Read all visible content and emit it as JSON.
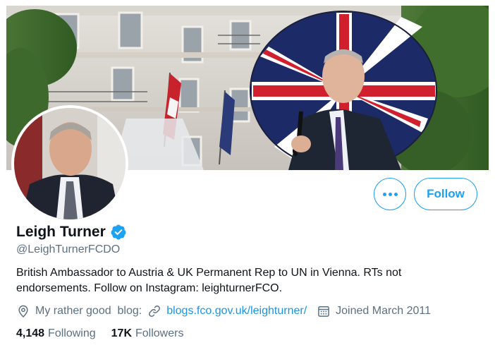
{
  "colors": {
    "accent": "#1da1f2",
    "link": "#1b95e0",
    "secondary_text": "#5b7083",
    "primary_text": "#0f1419"
  },
  "profile": {
    "display_name": "Leigh Turner",
    "verified": true,
    "handle": "@LeighTurnerFCDO",
    "bio": "British Ambassador to Austria & UK Permanent Rep to UN in Vienna. RTs not endorsements. Follow on Instagram: leighturnerFCO.",
    "location": "My rather good  blog:",
    "website": "blogs.fco.gov.uk/leighturner/",
    "joined": "Joined March 2011"
  },
  "stats": {
    "following_count": "4,148",
    "following_label": "Following",
    "followers_count": "17K",
    "followers_label": "Followers"
  },
  "actions": {
    "more_icon": "more-horizontal-icon",
    "follow_label": "Follow"
  },
  "icons": {
    "location": "location-pin-icon",
    "link": "link-icon",
    "calendar": "calendar-icon",
    "verified": "verified-badge-icon"
  }
}
